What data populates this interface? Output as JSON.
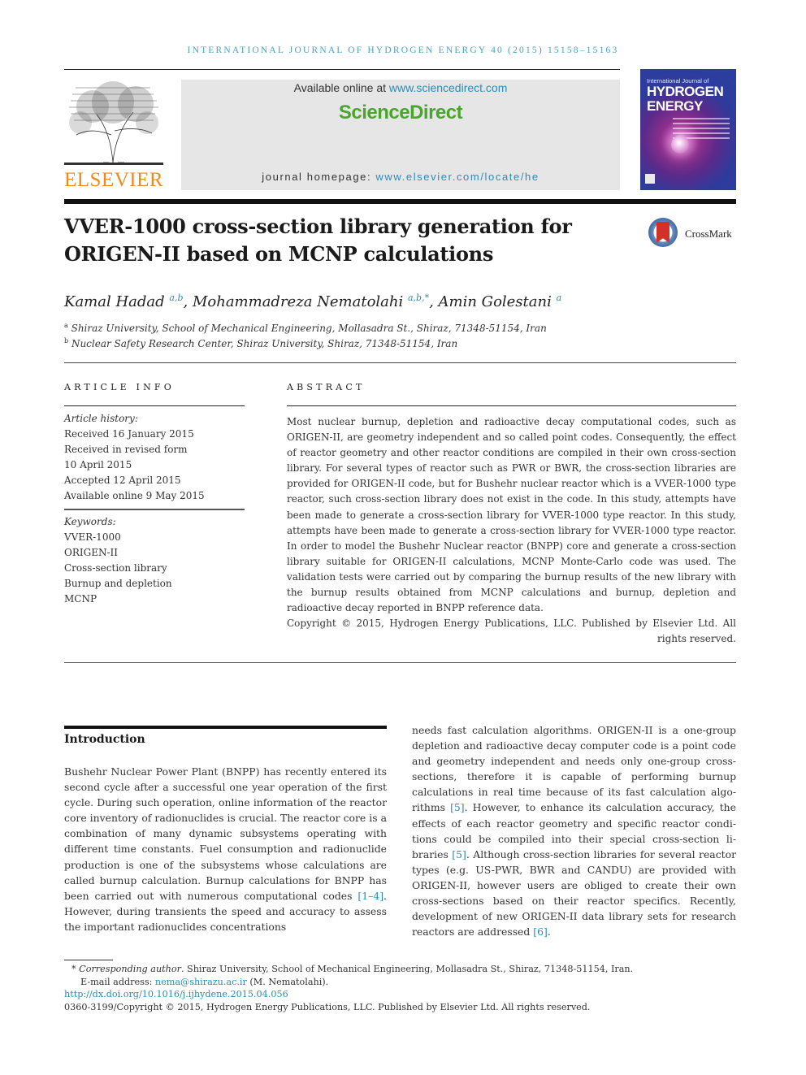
{
  "running_head": "INTERNATIONAL JOURNAL OF HYDROGEN ENERGY 40 (2015) 15158–15163",
  "masthead": {
    "publisher_logo": "ELSEVIER",
    "available_prefix": "Available online at ",
    "available_link": "www.sciencedirect.com",
    "platform_logo": "ScienceDirect",
    "homepage_prefix": "journal homepage: ",
    "homepage_link": "www.elsevier.com/locate/he",
    "cover": {
      "line1": "International Journal of",
      "line2": "HYDROGEN",
      "line3": "ENERGY"
    }
  },
  "article": {
    "title_line1": "VVER-1000 cross-section library generation for",
    "title_line2": "ORIGEN-II based on MCNP calculations",
    "crossmark_label": "CrossMark",
    "authors": [
      {
        "name": "Kamal Hadad",
        "sup": "a,b",
        "sep": ", "
      },
      {
        "name": "Mohammadreza Nematolahi",
        "sup": "a,b,*",
        "sep": ", "
      },
      {
        "name": "Amin Golestani",
        "sup": "a",
        "sep": ""
      }
    ],
    "affiliations": [
      {
        "mark": "a",
        "text": "Shiraz University, School of Mechanical Engineering, Mollasadra St., Shiraz, 71348-51154, Iran"
      },
      {
        "mark": "b",
        "text": "Nuclear Safety Research Center, Shiraz University, Shiraz, 71348-51154, Iran"
      }
    ]
  },
  "article_info": {
    "heading": "ARTICLE INFO",
    "history_label": "Article history:",
    "history": [
      "Received 16 January 2015",
      "Received in revised form",
      "10 April 2015",
      "Accepted 12 April 2015",
      "Available online 9 May 2015"
    ],
    "keywords_label": "Keywords:",
    "keywords": [
      "VVER-1000",
      "ORIGEN-II",
      "Cross-section library",
      "Burnup and depletion",
      "MCNP"
    ]
  },
  "abstract": {
    "heading": "ABSTRACT",
    "text": "Most nuclear burnup, depletion and radioactive decay computational codes, such as ORIGEN-II, are geometry independent and so called point codes. Consequently, the effect of reactor geometry and other reactor conditions are compiled in their own cross-section li­brary. For several types of reactor such as PWR or BWR, the cross-section libraries are provided for ORIGEN-II code, but for Bushehr nuclear reactor which is a VVER-1000 type reactor, such cross-section library does not exist in the code. In this study, attempts have been made to generate a cross-section library for VVER-1000 type reactor. In this study, attempts have been made to generate a cross-section library for VVER-1000 type reactor. In order to model the Bushehr Nuclear reactor (BNPP) core and generate a cross-section li­brary suitable for ORIGEN-II calculations, MCNP Monte-Carlo code was used. The validation tests were carried out by comparing the burnup results of the new library with the burnup results obtained from MCNP calculations and burnup, depletion and radioactive decay reported in BNPP reference data.",
    "copyright": "Copyright © 2015, Hydrogen Energy Publications, LLC. Published by Elsevier Ltd. All rights reserved."
  },
  "introduction": {
    "heading": "Introduction",
    "left_before_ref": "Bushehr Nuclear Power Plant (BNPP) has recently entered its second cycle after a successful one year operation of the first cycle. During such operation, online information of the reactor core inventory of radionuclides is crucial. The reactor core is a combination of many dynamic subsystems operating with different time constants. Fuel consumption and radio­nuclide production is one of the subsystems whose calcula­tions are called burnup calculation. Burnup calculations for BNPP has been carried out with numerous computational codes ",
    "ref_1_4": "[1–4]",
    "left_after_ref": ". However, during transients the speed and accu­racy to assess the important radionuclides concentrations",
    "right_part1": "needs fast calculation algorithms. ORIGEN-II is a one-group depletion and radioactive decay computer code is a point code and geometry independent and needs only one-group cross-sections, therefore it is capable of performing burnup calculations in real time because of its fast calculation algo­rithms ",
    "ref_5a": "[5]",
    "right_part2": ". However, to enhance its calculation accuracy, the effects of each reactor geometry and specific reactor condi­tions could be compiled into their special cross-section li­braries ",
    "ref_5b": "[5]",
    "right_part3": ". Although cross-section libraries for several reactor types (e.g. US-PWR, BWR and CANDU) are provided with ORIGEN-II, however users are obliged to create their own cross-sections based on their reactor specifics. Recently, development of new ORIGEN-II data library sets for research reactors are addressed ",
    "ref_6": "[6]",
    "right_part4": "."
  },
  "footnotes": {
    "star": "*",
    "corresponding_label": "Corresponding author",
    "corresponding_text": ". Shiraz University, School of Mechanical Engineering, Mollasadra St., Shiraz, 71348-51154, Iran.",
    "email_prefix": "E-mail address: ",
    "email": "nema@shirazu.ac.ir",
    "email_suffix": " (M. Nematolahi).",
    "doi": "http://dx.doi.org/10.1016/j.ijhydene.2015.04.056",
    "issn_copyright": "0360-3199/Copyright © 2015, Hydrogen Energy Publications, LLC. Published by Elsevier Ltd. All rights reserved."
  },
  "colors": {
    "link": "#2a8cb8",
    "elsevier_orange": "#f08a1c",
    "sciencedirect_green": "#4aa52e",
    "masthead_gray": "#e6e6e6"
  }
}
